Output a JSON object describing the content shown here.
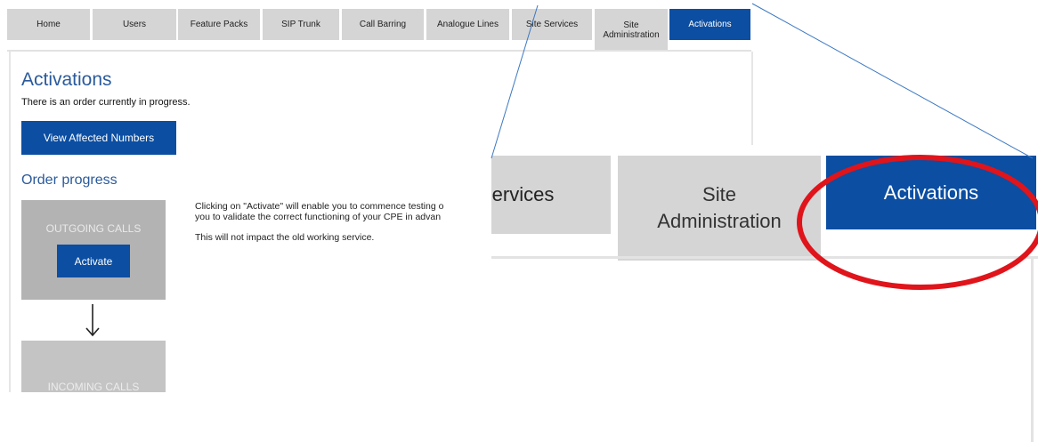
{
  "nav": {
    "tabs": [
      {
        "label": "Home"
      },
      {
        "label": "Users"
      },
      {
        "label": "Feature Packs"
      },
      {
        "label": "SIP Trunk"
      },
      {
        "label": "Call Barring"
      },
      {
        "label": "Analogue Lines"
      },
      {
        "label": "Site Services"
      },
      {
        "label": "Site Administration"
      },
      {
        "label": "Activations",
        "active": true
      }
    ]
  },
  "page": {
    "title": "Activations",
    "status_text": "There is an order currently in progress.",
    "view_button": "View Affected Numbers",
    "order_progress_title": "Order progress",
    "steps": {
      "outgoing": "OUTGOING CALLS",
      "activate_button": "Activate",
      "incoming": "INCOMING CALLS"
    },
    "description": {
      "line1": "Clicking on \"Activate\" will enable you to commence testing o",
      "line2": "you to validate the correct functioning of your CPE in advan",
      "line3": "This will not impact the old working service."
    }
  },
  "zoom": {
    "tabs": {
      "services": "Services",
      "site_admin": "Site Administration",
      "activations": "Activations"
    }
  },
  "colors": {
    "accent": "#0b4ea2",
    "tab_bg": "#d5d5d5",
    "heading": "#2a5a9b",
    "highlight_ring": "#e0141b"
  }
}
